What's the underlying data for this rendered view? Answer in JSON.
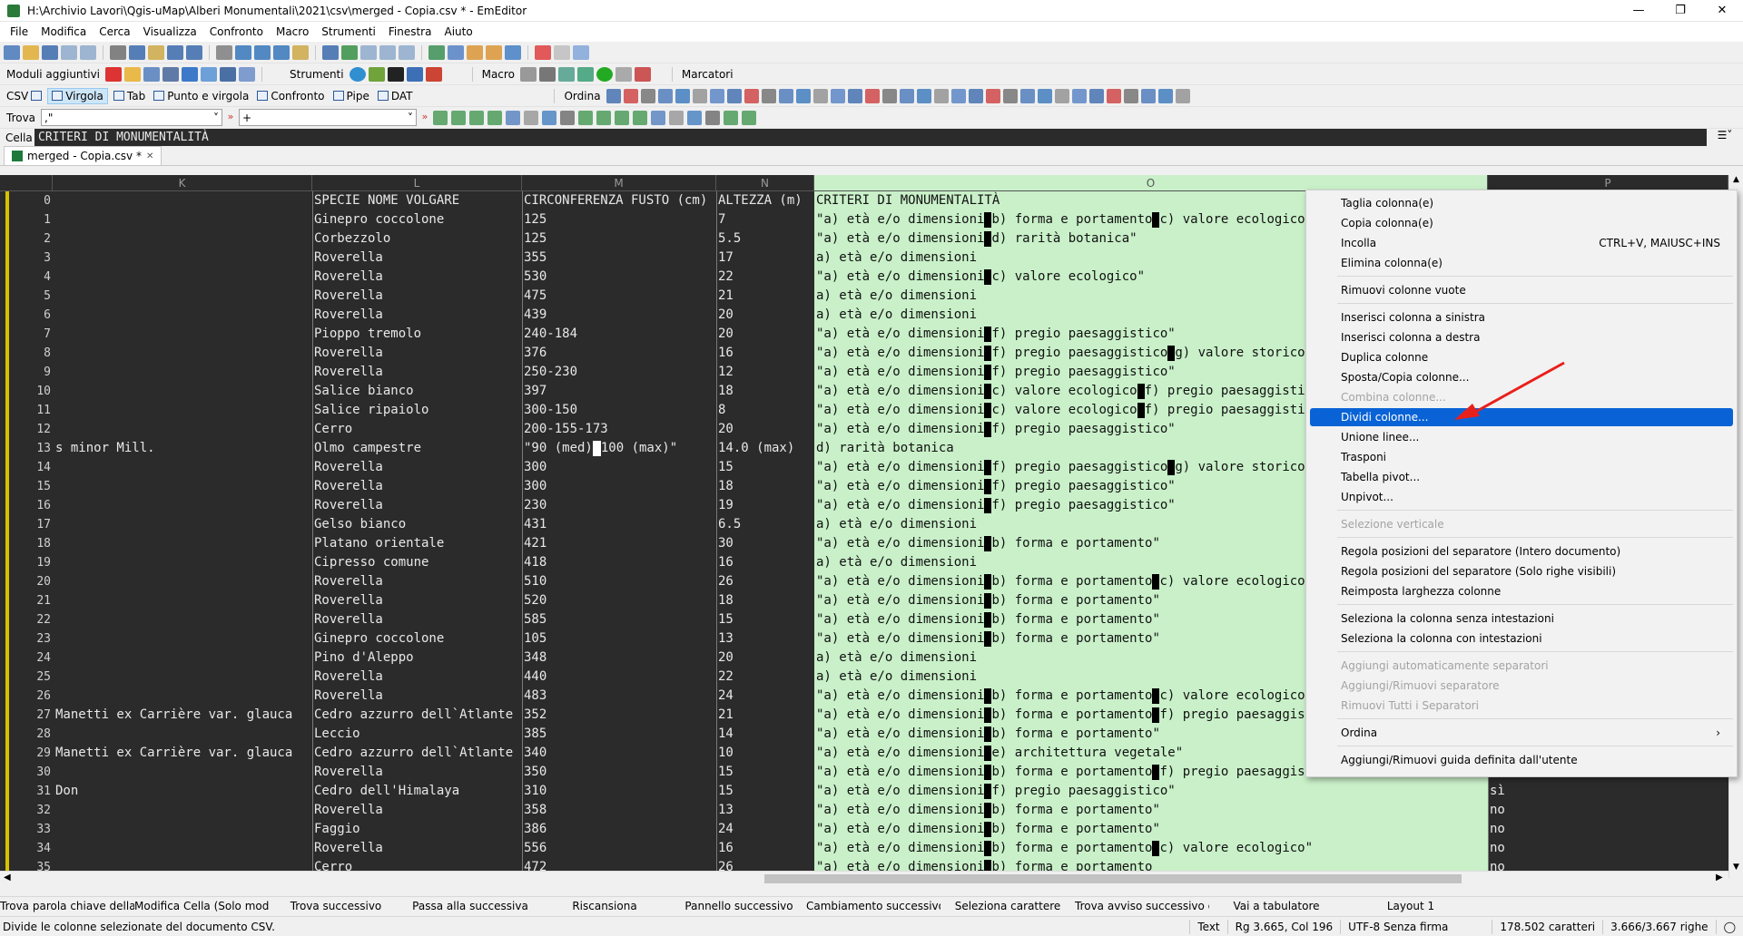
{
  "window": {
    "title": "H:\\Archivio Lavori\\Qgis-uMap\\Alberi Monumentali\\2021\\csv\\merged - Copia.csv * - EmEditor"
  },
  "menu": [
    "File",
    "Modifica",
    "Cerca",
    "Visualizza",
    "Confronto",
    "Macro",
    "Strumenti",
    "Finestra",
    "Aiuto"
  ],
  "toolbar2": {
    "plugins": "Moduli aggiuntivi",
    "tools": "Strumenti",
    "macro": "Macro",
    "markers": "Marcatori"
  },
  "toolbar3": {
    "csv": "CSV",
    "comma": "Virgola",
    "tab": "Tab",
    "semicolon": "Punto e virgola",
    "confront": "Confronto",
    "pipe": "Pipe",
    "dat": "DAT",
    "sort": "Ordina"
  },
  "findbar": {
    "label": "Trova",
    "find_value": ",\"",
    "replace_value": "+"
  },
  "cellbar": {
    "label": "Cella",
    "value": "CRITERI DI MONUMENTALITÀ"
  },
  "tab": {
    "name": "merged - Copia.csv *"
  },
  "columns": {
    "K": "K",
    "L": "L",
    "M": "M",
    "N": "N",
    "O": "O",
    "P": "P"
  },
  "rows": [
    {
      "n": "0",
      "k": "",
      "l": "SPECIE NOME VOLGARE",
      "m": "CIRCONFERENZA FUSTO (cm)",
      "nn": "ALTEZZA (m)",
      "o": [
        "CRITERI DI MONUMENTALITÀ"
      ]
    },
    {
      "n": "1",
      "k": "",
      "l": "Ginepro coccolone",
      "m": "125",
      "nn": "7",
      "o": [
        "\"a) età e/o dimensioni",
        "b) forma e portamento",
        "c) valore ecologico\""
      ]
    },
    {
      "n": "2",
      "k": "",
      "l": "Corbezzolo",
      "m": "125",
      "nn": "5.5",
      "o": [
        "\"a) età e/o dimensioni",
        "d) rarità botanica\""
      ]
    },
    {
      "n": "3",
      "k": "",
      "l": "Roverella",
      "m": "355",
      "nn": "17",
      "o": [
        "a) età e/o dimensioni"
      ]
    },
    {
      "n": "4",
      "k": "",
      "l": "Roverella",
      "m": "530",
      "nn": "22",
      "o": [
        "\"a) età e/o dimensioni",
        "c) valore ecologico\""
      ]
    },
    {
      "n": "5",
      "k": "",
      "l": "Roverella",
      "m": "475",
      "nn": "21",
      "o": [
        "a) età e/o dimensioni"
      ]
    },
    {
      "n": "6",
      "k": "",
      "l": "Roverella",
      "m": "439",
      "nn": "20",
      "o": [
        "a) età e/o dimensioni"
      ]
    },
    {
      "n": "7",
      "k": "",
      "l": "Pioppo tremolo",
      "m": "240-184",
      "nn": "20",
      "o": [
        "\"a) età e/o dimensioni",
        "f) pregio paesaggistico\""
      ]
    },
    {
      "n": "8",
      "k": "",
      "l": "Roverella",
      "m": "376",
      "nn": "16",
      "o": [
        "\"a) età e/o dimensioni",
        "f) pregio paesaggistico",
        "g) valore storico."
      ]
    },
    {
      "n": "9",
      "k": "",
      "l": "Roverella",
      "m": "250-230",
      "nn": "12",
      "o": [
        "\"a) età e/o dimensioni",
        "f) pregio paesaggistico\""
      ]
    },
    {
      "n": "10",
      "k": "",
      "l": "Salice bianco",
      "m": "397",
      "nn": "18",
      "o": [
        "\"a) età e/o dimensioni",
        "c) valore ecologico",
        "f) pregio paesaggistico"
      ]
    },
    {
      "n": "11",
      "k": "",
      "l": "Salice ripaiolo",
      "m": "300-150",
      "nn": "8",
      "o": [
        "\"a) età e/o dimensioni",
        "c) valore ecologico",
        "f) pregio paesaggistico"
      ]
    },
    {
      "n": "12",
      "k": "",
      "l": "Cerro",
      "m": "200-155-173",
      "nn": "20",
      "o": [
        "\"a) età e/o dimensioni",
        "f) pregio paesaggistico\""
      ]
    },
    {
      "n": "13",
      "k": "s minor Mill.",
      "l": "Olmo campestre",
      "m": "\"90 (med)",
      "m2": "100 (max)\"",
      "nn": "14.0 (max)",
      "o": [
        "d) rarità botanica"
      ]
    },
    {
      "n": "14",
      "k": "",
      "l": "Roverella",
      "m": "300",
      "nn": "15",
      "o": [
        "\"a) età e/o dimensioni",
        "f) pregio paesaggistico",
        "g) valore storico."
      ]
    },
    {
      "n": "15",
      "k": "",
      "l": "Roverella",
      "m": "300",
      "nn": "18",
      "o": [
        "\"a) età e/o dimensioni",
        "f) pregio paesaggistico\""
      ]
    },
    {
      "n": "16",
      "k": "",
      "l": "Roverella",
      "m": "230",
      "nn": "19",
      "o": [
        "\"a) età e/o dimensioni",
        "f) pregio paesaggistico\""
      ]
    },
    {
      "n": "17",
      "k": "",
      "l": "Gelso bianco",
      "m": "431",
      "nn": "6.5",
      "o": [
        "a) età e/o dimensioni"
      ]
    },
    {
      "n": "18",
      "k": "",
      "l": "Platano orientale",
      "m": "421",
      "nn": "30",
      "o": [
        "\"a) età e/o dimensioni",
        "b) forma e portamento\""
      ]
    },
    {
      "n": "19",
      "k": "",
      "l": "Cipresso comune",
      "m": "418",
      "nn": "16",
      "o": [
        "a) età e/o dimensioni"
      ]
    },
    {
      "n": "20",
      "k": "",
      "l": "Roverella",
      "m": "510",
      "nn": "26",
      "o": [
        "\"a) età e/o dimensioni",
        "b) forma e portamento",
        "c) valore ecologico\""
      ]
    },
    {
      "n": "21",
      "k": "",
      "l": "Roverella",
      "m": "520",
      "nn": "18",
      "o": [
        "\"a) età e/o dimensioni",
        "b) forma e portamento\""
      ]
    },
    {
      "n": "22",
      "k": "",
      "l": "Roverella",
      "m": "585",
      "nn": "15",
      "o": [
        "\"a) età e/o dimensioni",
        "b) forma e portamento\""
      ]
    },
    {
      "n": "23",
      "k": "",
      "l": "Ginepro coccolone",
      "m": "105",
      "nn": "13",
      "o": [
        "\"a) età e/o dimensioni",
        "b) forma e portamento\""
      ]
    },
    {
      "n": "24",
      "k": "",
      "l": "Pino d'Aleppo",
      "m": "348",
      "nn": "20",
      "o": [
        "a) età e/o dimensioni"
      ]
    },
    {
      "n": "25",
      "k": "",
      "l": "Roverella",
      "m": "440",
      "nn": "22",
      "o": [
        "a) età e/o dimensioni"
      ]
    },
    {
      "n": "26",
      "k": "",
      "l": "Roverella",
      "m": "483",
      "nn": "24",
      "o": [
        "\"a) età e/o dimensioni",
        "b) forma e portamento",
        "c) valore ecologico\""
      ]
    },
    {
      "n": "27",
      "k": "Manetti ex Carrière var. glauca",
      "l": "Cedro azzurro dell`Atlante",
      "m": "352",
      "nn": "21",
      "o": [
        "\"a) età e/o dimensioni",
        "b) forma e portamento",
        "f) pregio paesaggist"
      ]
    },
    {
      "n": "28",
      "k": "",
      "l": "Leccio",
      "m": "385",
      "nn": "14",
      "o": [
        "\"a) età e/o dimensioni",
        "b) forma e portamento\""
      ]
    },
    {
      "n": "29",
      "k": "Manetti ex Carrière var. glauca",
      "l": "Cedro azzurro dell`Atlante",
      "m": "340",
      "nn": "10",
      "o": [
        "\"a) età e/o dimensioni",
        "e) architettura vegetale\""
      ]
    },
    {
      "n": "30",
      "k": "",
      "l": "Roverella",
      "m": "350",
      "nn": "15",
      "o": [
        "\"a) età e/o dimensioni",
        "b) forma e portamento",
        "f) pregio paesaggistico"
      ],
      "p": ""
    },
    {
      "n": "31",
      "k": "Don",
      "l": "Cedro dell'Himalaya",
      "m": "310",
      "nn": "15",
      "o": [
        "\"a) età e/o dimensioni",
        "f) pregio paesaggistico\""
      ],
      "p": "sì"
    },
    {
      "n": "32",
      "k": "",
      "l": "Roverella",
      "m": "358",
      "nn": "13",
      "o": [
        "\"a) età e/o dimensioni",
        "b) forma e portamento\""
      ],
      "p": "no"
    },
    {
      "n": "33",
      "k": "",
      "l": "Faggio",
      "m": "386",
      "nn": "24",
      "o": [
        "\"a) età e/o dimensioni",
        "b) forma e portamento\""
      ],
      "p": "no"
    },
    {
      "n": "34",
      "k": "",
      "l": "Roverella",
      "m": "556",
      "nn": "16",
      "o": [
        "\"a) età e/o dimensioni",
        "b) forma e portamento",
        "c) valore ecologico\""
      ],
      "p": "no"
    },
    {
      "n": "35",
      "k": "",
      "l": "Cerro",
      "m": "472",
      "nn": "26",
      "o": [
        "\"a) età e/o dimensioni",
        "b) forma e portamento"
      ],
      "p": "no"
    }
  ],
  "context_menu": [
    {
      "label": "Taglia colonna(e)",
      "state": "normal"
    },
    {
      "label": "Copia colonna(e)",
      "state": "normal"
    },
    {
      "label": "Incolla",
      "state": "normal",
      "shortcut": "CTRL+V, MAIUSC+INS"
    },
    {
      "label": "Elimina colonna(e)",
      "state": "normal"
    },
    {
      "sep": true
    },
    {
      "label": "Rimuovi colonne vuote",
      "state": "normal"
    },
    {
      "sep": true
    },
    {
      "label": "Inserisci colonna a sinistra",
      "state": "normal"
    },
    {
      "label": "Inserisci colonna a destra",
      "state": "normal"
    },
    {
      "label": "Duplica colonne",
      "state": "normal"
    },
    {
      "label": "Sposta/Copia colonne...",
      "state": "normal"
    },
    {
      "label": "Combina colonne...",
      "state": "disabled"
    },
    {
      "label": "Dividi colonne...",
      "state": "highlight"
    },
    {
      "label": "Unione linee...",
      "state": "normal"
    },
    {
      "label": "Trasponi",
      "state": "normal"
    },
    {
      "label": "Tabella pivot...",
      "state": "normal"
    },
    {
      "label": "Unpivot...",
      "state": "normal"
    },
    {
      "sep": true
    },
    {
      "label": "Selezione verticale",
      "state": "disabled"
    },
    {
      "sep": true
    },
    {
      "label": "Regola posizioni del separatore (Intero documento)",
      "state": "normal"
    },
    {
      "label": "Regola posizioni del separatore (Solo righe visibili)",
      "state": "normal"
    },
    {
      "label": "Reimposta larghezza colonne",
      "state": "normal"
    },
    {
      "sep": true
    },
    {
      "label": "Seleziona la colonna senza intestazioni",
      "state": "normal"
    },
    {
      "label": "Seleziona la colonna con intestazioni",
      "state": "normal"
    },
    {
      "sep": true
    },
    {
      "label": "Aggiungi automaticamente separatori",
      "state": "disabled"
    },
    {
      "label": "Aggiungi/Rimuovi separatore",
      "state": "disabled"
    },
    {
      "label": "Rimuovi Tutti i Separatori",
      "state": "disabled"
    },
    {
      "sep": true
    },
    {
      "label": "Ordina",
      "state": "normal",
      "submenu": true
    },
    {
      "sep": true
    },
    {
      "label": "Aggiungi/Rimuovi guida definita dall'utente",
      "state": "normal"
    }
  ],
  "fkeys": [
    "Trova parola chiave della m...",
    "Modifica Cella (Solo modal...",
    "Trova successivo",
    "Passa alla successiva",
    "Riscansiona",
    "Pannello successivo",
    "Cambiamento successivo",
    "Seleziona carattere",
    "Trova avviso successivo car...",
    "Vai a tabulatore",
    "Layout 1"
  ],
  "status": {
    "message": "Divide le colonne selezionate del documento CSV.",
    "mode": "Text",
    "position": "Rg 3.665, Col 196",
    "encoding": "UTF-8 Senza firma",
    "chars": "178.502 caratteri",
    "lines": "3.666/3.667 righe"
  },
  "colors": {
    "grid_bg": "#2b2b2b",
    "selected_col": "#c9f0c9",
    "highlight": "#0a63d6",
    "arrow": "#e8201c"
  }
}
